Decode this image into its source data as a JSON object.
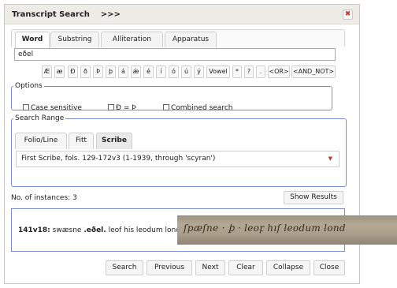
{
  "window": {
    "title": "Transcript Search",
    "title_suffix": ">>>",
    "close_symbol": "✖"
  },
  "tabs": [
    "Word",
    "Substring",
    "Alliteration",
    "Apparatus"
  ],
  "search_input": {
    "value": "eðel"
  },
  "char_buttons": [
    "Æ",
    "æ",
    "Ð",
    "ð",
    "Þ",
    "þ",
    "á",
    "ǽ",
    "é",
    "í",
    "ó",
    "ú",
    "ý",
    "Vowel",
    "*",
    "?",
    ".",
    "<OR>",
    "<AND_NOT>"
  ],
  "options": {
    "legend": "Options",
    "case_sensitive": "Case sensitive",
    "eth_thorn": "Ð = Þ",
    "combined": "Combined search"
  },
  "search_range": {
    "legend": "Search Range",
    "tabs": [
      "Folio/Line",
      "Fitt",
      "Scribe"
    ],
    "selected": "First Scribe, fols. 129-172v3 (1-1939, through 'scyran')"
  },
  "instances": {
    "label": "No. of instances:",
    "count": "3"
  },
  "show_results_label": "Show Results",
  "result": {
    "ref": "141v18:",
    "before": "swæsne",
    "match": ".eðel.",
    "after": "leof his leodum lond"
  },
  "manuscript_text": "ſpæſne · ꝧ · leoꝼ hıſ leodum lond",
  "buttons": [
    "Search",
    "Previous",
    "Next",
    "Clear",
    "Collapse",
    "Close"
  ],
  "colors": {
    "fieldset_border": "#7b8fd0",
    "close_icon": "#c0392b",
    "titlebar": "#eeece6"
  }
}
